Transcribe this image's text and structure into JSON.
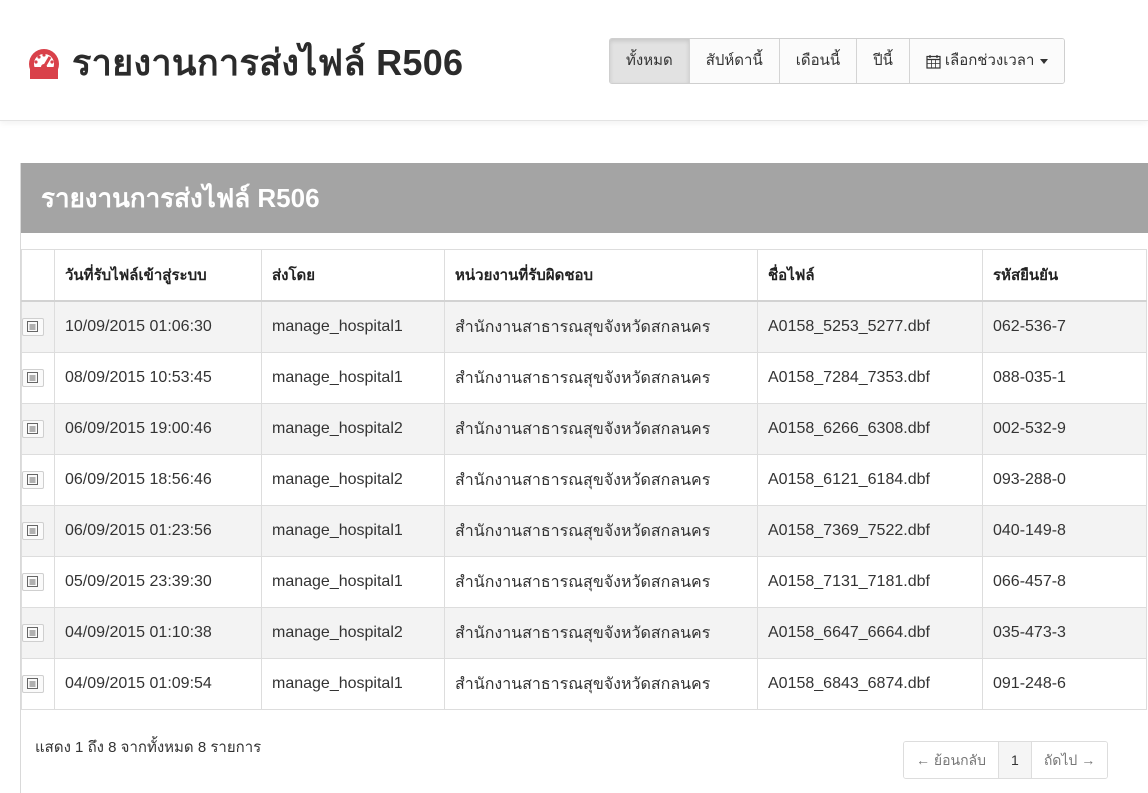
{
  "header": {
    "title": "รายงานการส่งไฟล์ R506",
    "icon": "dashboard-icon",
    "icon_color": "#d9414a"
  },
  "range_filter": {
    "buttons": [
      {
        "label": "ทั้งหมด",
        "active": true
      },
      {
        "label": "สัปห์ดานี้",
        "active": false
      },
      {
        "label": "เดือนนี้",
        "active": false
      },
      {
        "label": "ปีนี้",
        "active": false
      }
    ],
    "custom_range_label": "เลือกช่วงเวลา",
    "custom_range_icon": "calendar-icon"
  },
  "panel": {
    "heading": "รายงานการส่งไฟล์ R506",
    "heading_bg": "#a4a4a4"
  },
  "table": {
    "columns": [
      "",
      "วันที่รับไฟล์เข้าสู่ระบบ",
      "ส่งโดย",
      "หน่วยงานที่รับผิดชอบ",
      "ชื่อไฟล์",
      "รหัสยืนยัน"
    ],
    "rows": [
      {
        "received": "10/09/2015 01:06:30",
        "sender": "manage_hospital1",
        "agency": "สำนักงานสาธารณสุขจังหวัดสกลนคร",
        "file": "A0158_5253_5277.dbf",
        "code": "062-536-7"
      },
      {
        "received": "08/09/2015 10:53:45",
        "sender": "manage_hospital1",
        "agency": "สำนักงานสาธารณสุขจังหวัดสกลนคร",
        "file": "A0158_7284_7353.dbf",
        "code": "088-035-1"
      },
      {
        "received": "06/09/2015 19:00:46",
        "sender": "manage_hospital2",
        "agency": "สำนักงานสาธารณสุขจังหวัดสกลนคร",
        "file": "A0158_6266_6308.dbf",
        "code": "002-532-9"
      },
      {
        "received": "06/09/2015 18:56:46",
        "sender": "manage_hospital2",
        "agency": "สำนักงานสาธารณสุขจังหวัดสกลนคร",
        "file": "A0158_6121_6184.dbf",
        "code": "093-288-0"
      },
      {
        "received": "06/09/2015 01:23:56",
        "sender": "manage_hospital1",
        "agency": "สำนักงานสาธารณสุขจังหวัดสกลนคร",
        "file": "A0158_7369_7522.dbf",
        "code": "040-149-8"
      },
      {
        "received": "05/09/2015 23:39:30",
        "sender": "manage_hospital1",
        "agency": "สำนักงานสาธารณสุขจังหวัดสกลนคร",
        "file": "A0158_7131_7181.dbf",
        "code": "066-457-8"
      },
      {
        "received": "04/09/2015 01:10:38",
        "sender": "manage_hospital2",
        "agency": "สำนักงานสาธารณสุขจังหวัดสกลนคร",
        "file": "A0158_6647_6664.dbf",
        "code": "035-473-3"
      },
      {
        "received": "04/09/2015 01:09:54",
        "sender": "manage_hospital1",
        "agency": "สำนักงานสาธารณสุขจังหวัดสกลนคร",
        "file": "A0158_6843_6874.dbf",
        "code": "091-248-6"
      }
    ]
  },
  "footer": {
    "info": "แสดง 1 ถึง 8 จากทั้งหมด 8 รายการ",
    "pagination": {
      "prev_label": "← ย้อนกลับ",
      "current_page": "1",
      "next_label": "ถัดไป →"
    }
  }
}
